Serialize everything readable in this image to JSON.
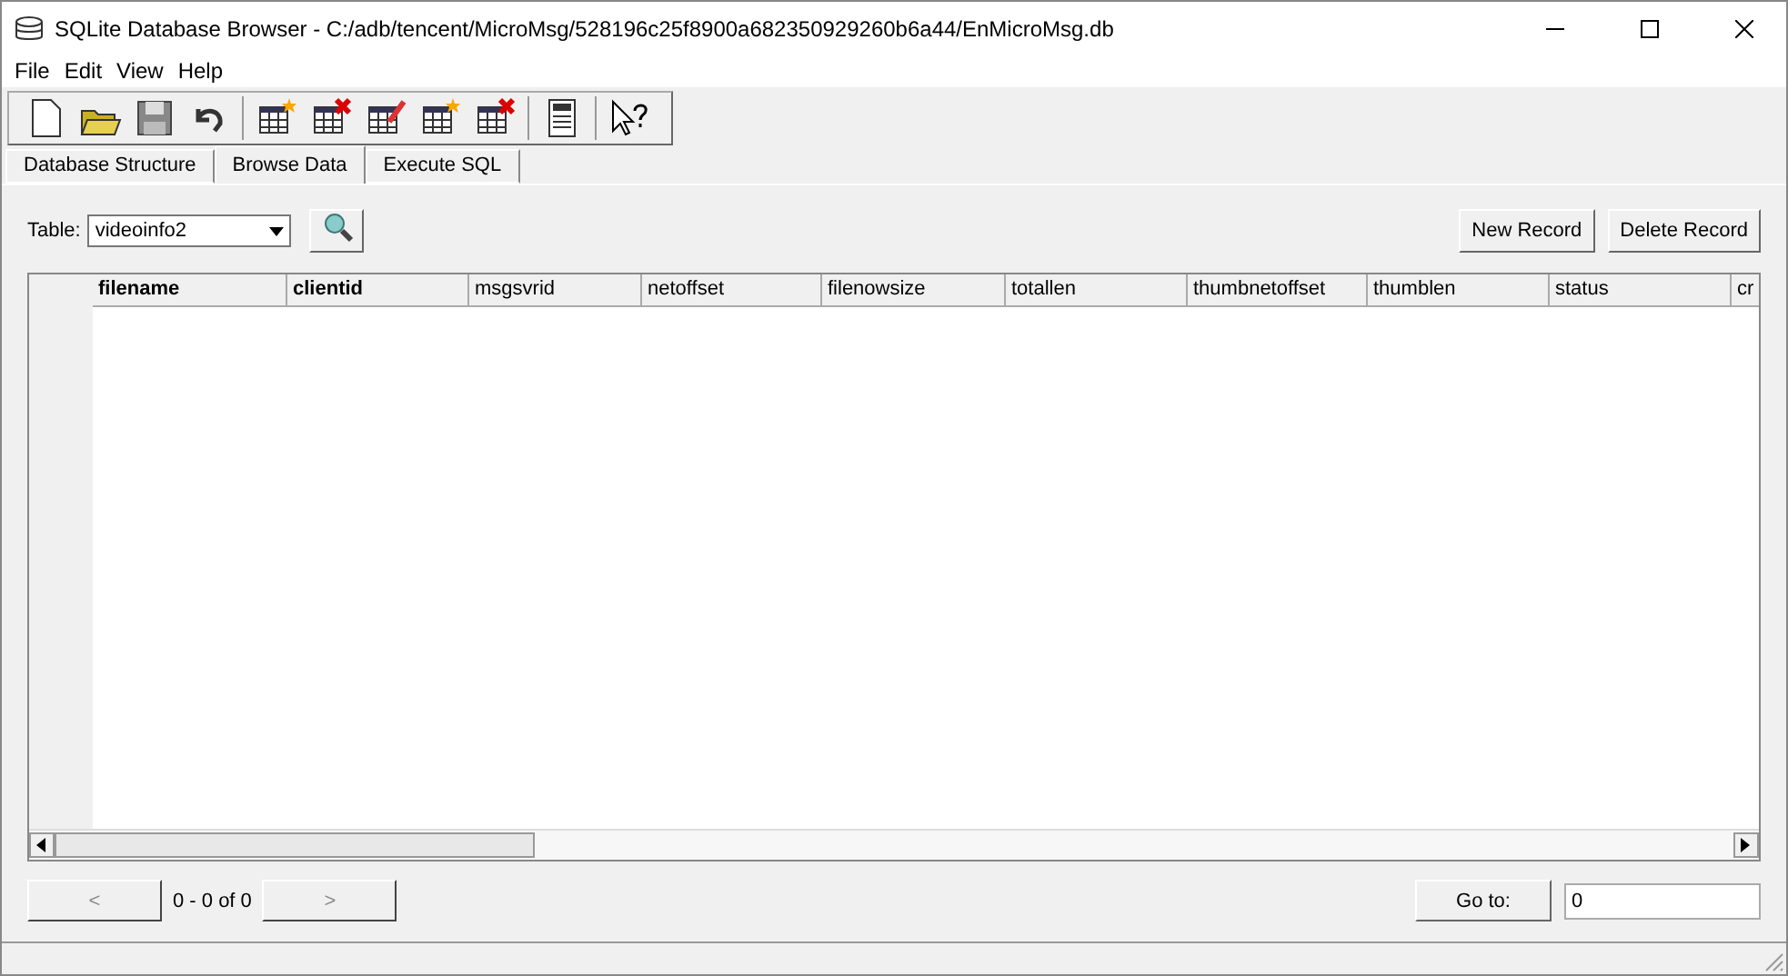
{
  "window": {
    "title": "SQLite Database Browser - C:/adb/tencent/MicroMsg/528196c25f8900a682350929260b6a44/EnMicroMsg.db"
  },
  "menu": [
    "File",
    "Edit",
    "View",
    "Help"
  ],
  "tabs": [
    {
      "label": "Database Structure",
      "selected": false
    },
    {
      "label": "Browse Data",
      "selected": true
    },
    {
      "label": "Execute SQL",
      "selected": false
    }
  ],
  "table_select": {
    "label": "Table:",
    "value": "videoinfo2"
  },
  "buttons": [
    "New Record",
    "Delete Record"
  ],
  "columns": [
    {
      "label": "filename",
      "bold": true
    },
    {
      "label": "clientid",
      "bold": true
    },
    {
      "label": "msgsvrid",
      "bold": false
    },
    {
      "label": "netoffset",
      "bold": false
    },
    {
      "label": "filenowsize",
      "bold": false
    },
    {
      "label": "totallen",
      "bold": false
    },
    {
      "label": "thumbnetoffset",
      "bold": false
    },
    {
      "label": "thumblen",
      "bold": false
    },
    {
      "label": "status",
      "bold": false
    },
    {
      "label": "cr",
      "bold": false
    }
  ],
  "pager": {
    "prev": "<",
    "range": "0 - 0 of 0",
    "next": ">"
  },
  "goto": {
    "label": "Go to:",
    "value": "0"
  }
}
